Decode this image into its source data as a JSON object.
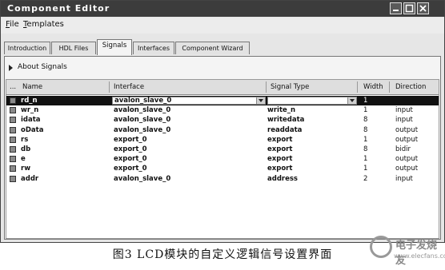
{
  "window": {
    "title": "Component Editor"
  },
  "menu": [
    {
      "acc": "F",
      "rest": "ile"
    },
    {
      "acc": "T",
      "rest": "emplates"
    }
  ],
  "tabs": [
    "Introduction",
    "HDL Files",
    "Signals",
    "Interfaces",
    "Component Wizard"
  ],
  "active_tab": "Signals",
  "about": "About Signals",
  "columns": [
    "...",
    "Name",
    "Interface",
    "Signal Type",
    "Width",
    "Direction"
  ],
  "rows": [
    {
      "name": "rd_n",
      "interface": "avalon_slave_0",
      "signal_type": "",
      "width": "1",
      "direction": ""
    },
    {
      "name": "wr_n",
      "interface": "avalon_slave_0",
      "signal_type": "write_n",
      "width": "1",
      "direction": "input"
    },
    {
      "name": "idata",
      "interface": "avalon_slave_0",
      "signal_type": "writedata",
      "width": "8",
      "direction": "input"
    },
    {
      "name": "oData",
      "interface": "avalon_slave_0",
      "signal_type": "readdata",
      "width": "8",
      "direction": "output"
    },
    {
      "name": "rs",
      "interface": "export_0",
      "signal_type": "export",
      "width": "1",
      "direction": "output"
    },
    {
      "name": "db",
      "interface": "export_0",
      "signal_type": "export",
      "width": "8",
      "direction": "bidir"
    },
    {
      "name": "e",
      "interface": "export_0",
      "signal_type": "export",
      "width": "1",
      "direction": "output"
    },
    {
      "name": "rw",
      "interface": "export_0",
      "signal_type": "export",
      "width": "1",
      "direction": "output"
    },
    {
      "name": "addr",
      "interface": "avalon_slave_0",
      "signal_type": "address",
      "width": "2",
      "direction": "input"
    }
  ],
  "caption": "图3   LCD模块的自定义逻辑信号设置界面",
  "watermark": {
    "line1": "电子发烧友",
    "line2": "www.elecfans.com"
  }
}
